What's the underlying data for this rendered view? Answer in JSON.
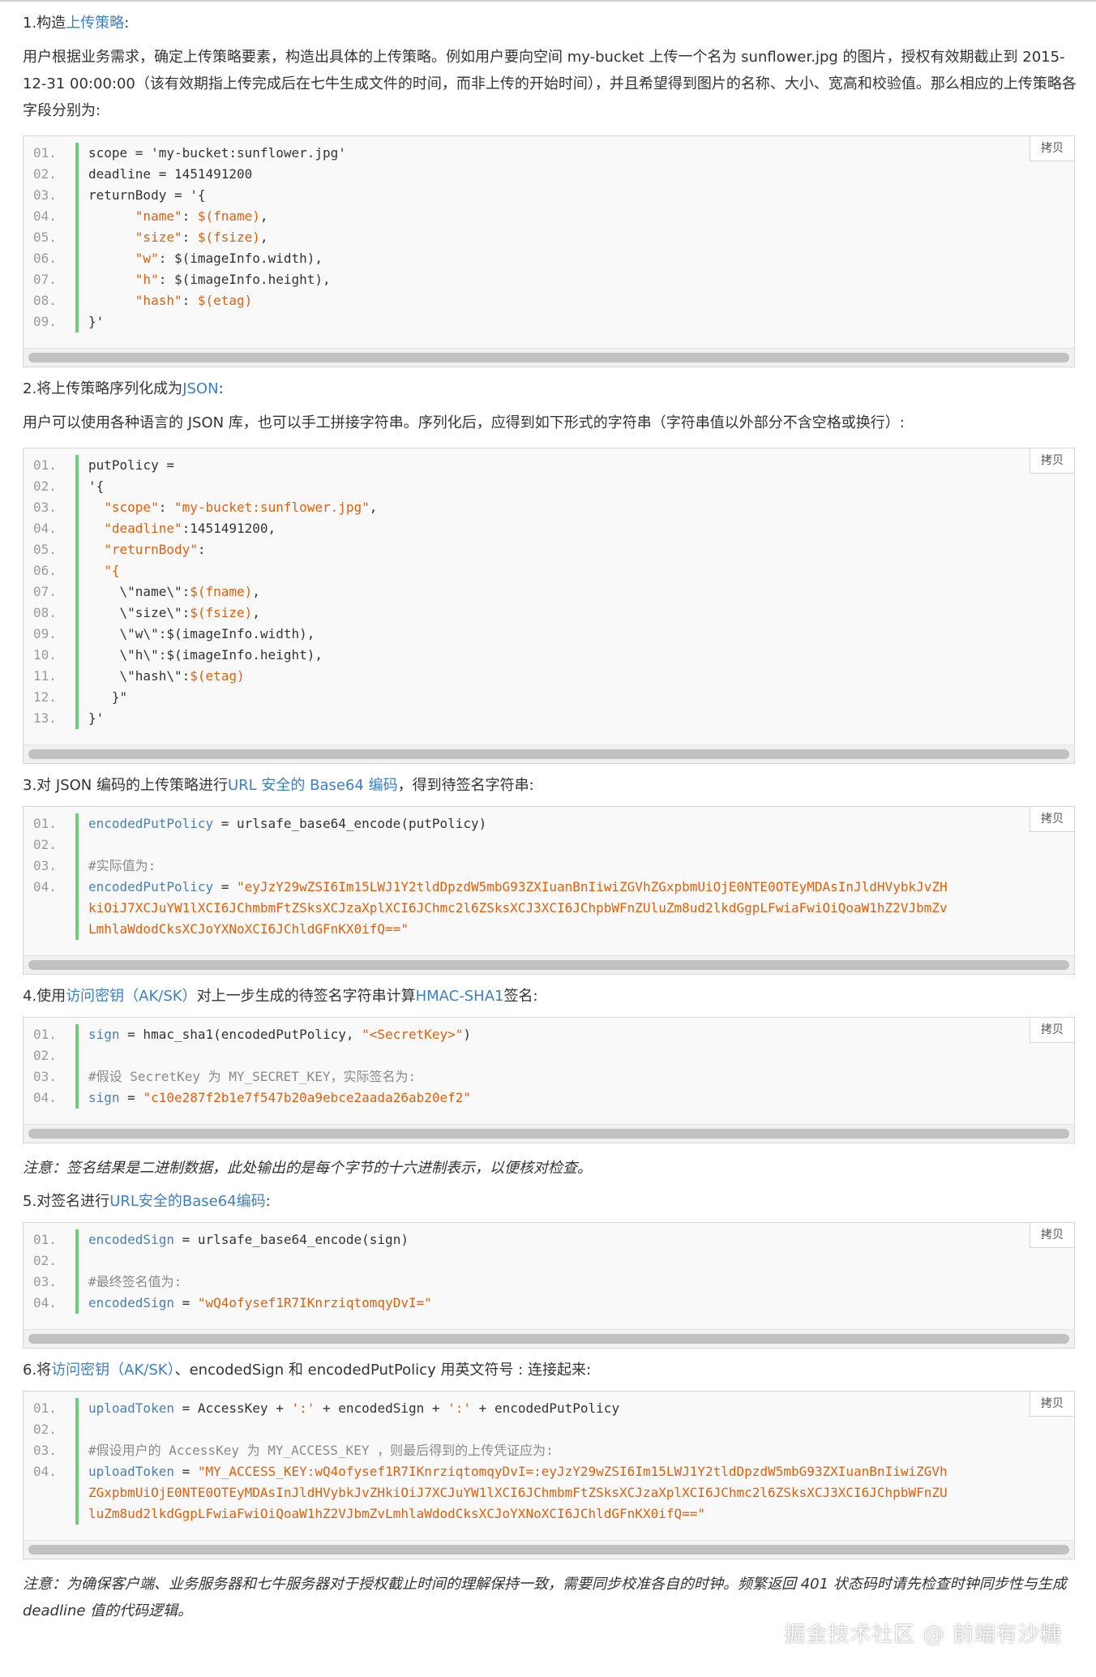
{
  "copy_label": "拷贝",
  "steps": {
    "s1": {
      "pre": "1.构造",
      "link": "上传策略",
      "post": ":"
    },
    "s2": {
      "pre": "2.将上传策略序列化成为",
      "link": "JSON",
      "post": ":"
    },
    "s3": {
      "pre": "3.对 JSON 编码的上传策略进行",
      "link": "URL 安全的 Base64 编码",
      "post": "，得到待签名字符串:"
    },
    "s4": {
      "pre": "4.使用",
      "link": "访问密钥（AK/SK）",
      "mid": "对上一步生成的待签名字符串计算",
      "link2": "HMAC-SHA1",
      "post": "签名:"
    },
    "s5": {
      "pre": "5.对签名进行",
      "link": "URL安全的Base64编码",
      "post": ":"
    },
    "s6": {
      "pre": "6.将",
      "link": "访问密钥（AK/SK）",
      "post": "、encodedSign 和 encodedPutPolicy 用英文符号 : 连接起来:"
    }
  },
  "para1": "用户根据业务需求，确定上传策略要素，构造出具体的上传策略。例如用户要向空间 my-bucket 上传一个名为 sunflower.jpg 的图片，授权有效期截止到 2015-12-31 00:00:00（该有效期指上传完成后在七牛生成文件的时间，而非上传的开始时间），并且希望得到图片的名称、大小、宽高和校验值。那么相应的上传策略各字段分别为:",
  "para2": "用户可以使用各种语言的 JSON 库，也可以手工拼接字符串。序列化后，应得到如下形式的字符串（字符串值以外部分不含空格或换行）:",
  "note1": "注意：签名结果是二进制数据，此处输出的是每个字节的十六进制表示，以便核对检查。",
  "note2": "注意：为确保客户端、业务服务器和七牛服务器对于授权截止时间的理解保持一致，需要同步校准各自的时钟。频繁返回 401 状态码时请先检查时钟同步性与生成 deadline 值的代码逻辑。",
  "watermark": "掘金技术社区 @ 前端有沙糖",
  "code1": {
    "nums": [
      "01.",
      "02.",
      "03.",
      "04.",
      "05.",
      "06.",
      "07.",
      "08.",
      "09."
    ],
    "lines": [
      [
        [
          "",
          "scope = 'my-bucket:sunflower.jpg'"
        ]
      ],
      [
        [
          "",
          "deadline = 1451491200"
        ]
      ],
      [
        [
          "",
          "returnBody = '{"
        ]
      ],
      [
        [
          "",
          "      "
        ],
        [
          "s",
          "\"name\""
        ],
        [
          "",
          ": "
        ],
        [
          "s",
          "$(fname)"
        ],
        [
          "",
          ","
        ]
      ],
      [
        [
          "",
          "      "
        ],
        [
          "s",
          "\"size\""
        ],
        [
          "",
          ": "
        ],
        [
          "s",
          "$(fsize)"
        ],
        [
          "",
          ","
        ]
      ],
      [
        [
          "",
          "      "
        ],
        [
          "s",
          "\"w\""
        ],
        [
          "",
          ": $(imageInfo.width),"
        ]
      ],
      [
        [
          "",
          "      "
        ],
        [
          "s",
          "\"h\""
        ],
        [
          "",
          ": $(imageInfo.height),"
        ]
      ],
      [
        [
          "",
          "      "
        ],
        [
          "s",
          "\"hash\""
        ],
        [
          "",
          ": "
        ],
        [
          "s",
          "$(etag)"
        ]
      ],
      [
        [
          "",
          "}'"
        ]
      ]
    ]
  },
  "code2": {
    "nums": [
      "01.",
      "02.",
      "03.",
      "04.",
      "05.",
      "06.",
      "07.",
      "08.",
      "09.",
      "10.",
      "11.",
      "12.",
      "13."
    ],
    "lines": [
      [
        [
          "",
          "putPolicy ="
        ]
      ],
      [
        [
          "",
          "'{"
        ]
      ],
      [
        [
          "",
          "  "
        ],
        [
          "s",
          "\"scope\""
        ],
        [
          "",
          ": "
        ],
        [
          "s",
          "\"my-bucket:sunflower.jpg\""
        ],
        [
          "",
          ","
        ]
      ],
      [
        [
          "",
          "  "
        ],
        [
          "s",
          "\"deadline\""
        ],
        [
          "",
          ":1451491200,"
        ]
      ],
      [
        [
          "",
          "  "
        ],
        [
          "s",
          "\"returnBody\""
        ],
        [
          "",
          ":"
        ]
      ],
      [
        [
          "",
          "  "
        ],
        [
          "s",
          "\"{"
        ]
      ],
      [
        [
          "",
          "    \\\"name\\\":"
        ],
        [
          "s",
          "$(fname)"
        ],
        [
          "",
          ","
        ]
      ],
      [
        [
          "",
          "    \\\"size\\\":"
        ],
        [
          "s",
          "$(fsize)"
        ],
        [
          "",
          ","
        ]
      ],
      [
        [
          "",
          "    \\\"w\\\":$(imageInfo.width),"
        ]
      ],
      [
        [
          "",
          "    \\\"h\\\":$(imageInfo.height),"
        ]
      ],
      [
        [
          "",
          "    \\\"hash\\\":"
        ],
        [
          "s",
          "$(etag)"
        ]
      ],
      [
        [
          "",
          "   }\""
        ]
      ],
      [
        [
          "",
          "}'"
        ]
      ]
    ]
  },
  "code3": {
    "nums": [
      "01.",
      "02.",
      "03.",
      "04.",
      "",
      ""
    ],
    "lines": [
      [
        [
          "k",
          "encodedPutPolicy"
        ],
        [
          "",
          " = urlsafe_base64_encode(putPolicy)"
        ]
      ],
      [
        [
          "",
          ""
        ]
      ],
      [
        [
          "c",
          "#实际值为:"
        ]
      ],
      [
        [
          "k",
          "encodedPutPolicy"
        ],
        [
          "",
          " = "
        ],
        [
          "s",
          "\"eyJzY29wZSI6Im15LWJ1Y2tldDpzdW5mbG93ZXIuanBnIiwiZGVhZGxpbmUiOjE0NTE0OTEyMDAsInJldHVybkJvZH"
        ]
      ],
      [
        [
          "s",
          "kiOiJ7XCJuYW1lXCI6JChmbmFtZSksXCJzaXplXCI6JChmc2l6ZSksXCJ3XCI6JChpbWFnZUluZm8ud2lkdGgpLFwiaFwiOiQoaW1hZ2VJbmZv"
        ]
      ],
      [
        [
          "s",
          "LmhlaWdodCksXCJoYXNoXCI6JChldGFnKX0ifQ==\""
        ]
      ]
    ]
  },
  "code4": {
    "nums": [
      "01.",
      "02.",
      "03.",
      "04."
    ],
    "lines": [
      [
        [
          "k",
          "sign"
        ],
        [
          "",
          " = hmac_sha1(encodedPutPolicy, "
        ],
        [
          "s",
          "\"<SecretKey>\""
        ],
        [
          "",
          ")"
        ]
      ],
      [
        [
          "",
          ""
        ]
      ],
      [
        [
          "c",
          "#假设 SecretKey 为 MY_SECRET_KEY，实际签名为:"
        ]
      ],
      [
        [
          "k",
          "sign"
        ],
        [
          "",
          " = "
        ],
        [
          "s",
          "\"c10e287f2b1e7f547b20a9ebce2aada26ab20ef2\""
        ]
      ]
    ]
  },
  "code5": {
    "nums": [
      "01.",
      "02.",
      "03.",
      "04."
    ],
    "lines": [
      [
        [
          "k",
          "encodedSign"
        ],
        [
          "",
          " = urlsafe_base64_encode(sign)"
        ]
      ],
      [
        [
          "",
          ""
        ]
      ],
      [
        [
          "c",
          "#最终签名值为:"
        ]
      ],
      [
        [
          "k",
          "encodedSign"
        ],
        [
          "",
          " = "
        ],
        [
          "s",
          "\"wQ4ofysef1R7IKnrziqtomqyDvI=\""
        ]
      ]
    ]
  },
  "code6": {
    "nums": [
      "01.",
      "02.",
      "03.",
      "04.",
      "",
      ""
    ],
    "lines": [
      [
        [
          "k",
          "uploadToken"
        ],
        [
          "",
          " = AccessKey + "
        ],
        [
          "s",
          "':'"
        ],
        [
          "",
          " + encodedSign + "
        ],
        [
          "s",
          "':'"
        ],
        [
          "",
          " + encodedPutPolicy"
        ]
      ],
      [
        [
          "",
          ""
        ]
      ],
      [
        [
          "c",
          "#假设用户的 AccessKey 为 MY_ACCESS_KEY ，则最后得到的上传凭证应为:"
        ]
      ],
      [
        [
          "k",
          "uploadToken"
        ],
        [
          "",
          " = "
        ],
        [
          "s",
          "\"MY_ACCESS_KEY:wQ4ofysef1R7IKnrziqtomqyDvI=:eyJzY29wZSI6Im15LWJ1Y2tldDpzdW5mbG93ZXIuanBnIiwiZGVh"
        ]
      ],
      [
        [
          "s",
          "ZGxpbmUiOjE0NTE0OTEyMDAsInJldHVybkJvZHkiOiJ7XCJuYW1lXCI6JChmbmFtZSksXCJzaXplXCI6JChmc2l6ZSksXCJ3XCI6JChpbWFnZU"
        ]
      ],
      [
        [
          "s",
          "luZm8ud2lkdGgpLFwiaFwiOiQoaW1hZ2VJbmZvLmhlaWdodCksXCJoYXNoXCI6JChldGFnKX0ifQ==\""
        ]
      ]
    ]
  }
}
